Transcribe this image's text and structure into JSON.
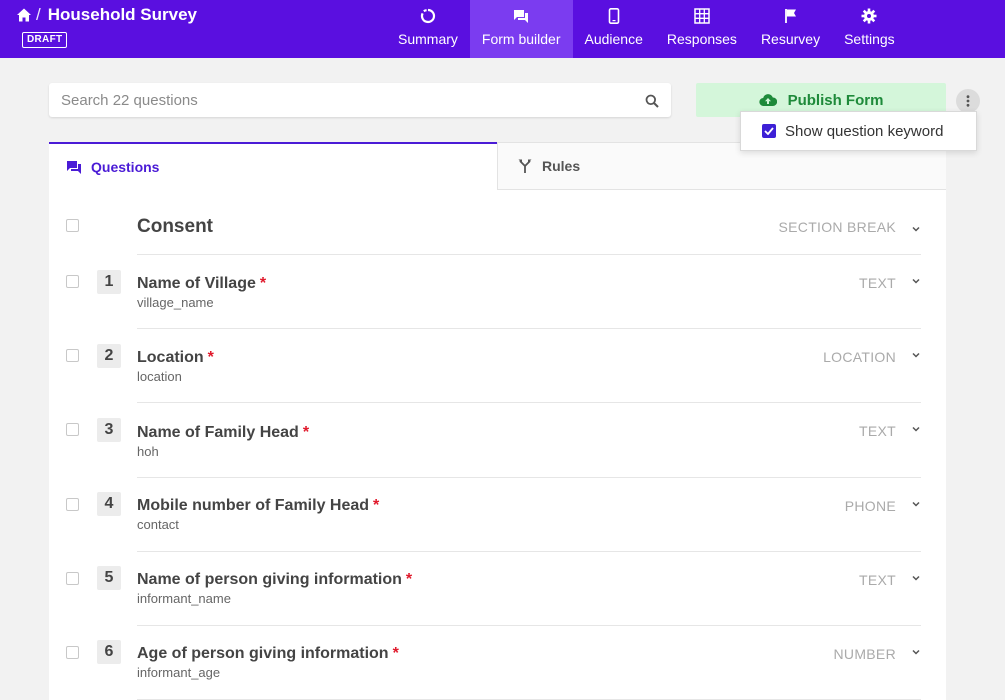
{
  "header": {
    "breadcrumb_sep": "/",
    "title": "Household Survey",
    "badge": "DRAFT",
    "tabs": [
      {
        "label": "Summary",
        "icon": "summary-icon"
      },
      {
        "label": "Form builder",
        "icon": "chat-icon",
        "active": true
      },
      {
        "label": "Audience",
        "icon": "phone-icon"
      },
      {
        "label": "Responses",
        "icon": "grid-icon"
      },
      {
        "label": "Resurvey",
        "icon": "flag-icon"
      },
      {
        "label": "Settings",
        "icon": "gear-icon"
      }
    ],
    "colors": {
      "bar": "#5a0fe0",
      "active_tab": "#7b3cf0"
    }
  },
  "search": {
    "placeholder": "Search 22 questions",
    "value": ""
  },
  "publish": {
    "label": "Publish Form",
    "color": "#1e8a3a",
    "bg": "#d4f6da"
  },
  "menu": {
    "option_label": "Show question keyword",
    "checked": true
  },
  "tabs": {
    "questions": "Questions",
    "rules": "Rules"
  },
  "questions": [
    {
      "title": "Consent",
      "type": "SECTION BREAK",
      "section": true
    },
    {
      "num": "1",
      "title": "Name of Village",
      "required": "*",
      "keyword": "village_name",
      "type": "TEXT"
    },
    {
      "num": "2",
      "title": "Location",
      "required": "*",
      "keyword": "location",
      "type": "LOCATION"
    },
    {
      "num": "3",
      "title": "Name of Family Head",
      "required": "*",
      "keyword": "hoh",
      "type": "TEXT"
    },
    {
      "num": "4",
      "title": "Mobile number of Family Head",
      "required": "*",
      "keyword": "contact",
      "type": "PHONE"
    },
    {
      "num": "5",
      "title": "Name of person giving information",
      "required": "*",
      "keyword": "informant_name",
      "type": "TEXT"
    },
    {
      "num": "6",
      "title": "Age of person giving information",
      "required": "*",
      "keyword": "informant_age",
      "type": "NUMBER"
    }
  ]
}
